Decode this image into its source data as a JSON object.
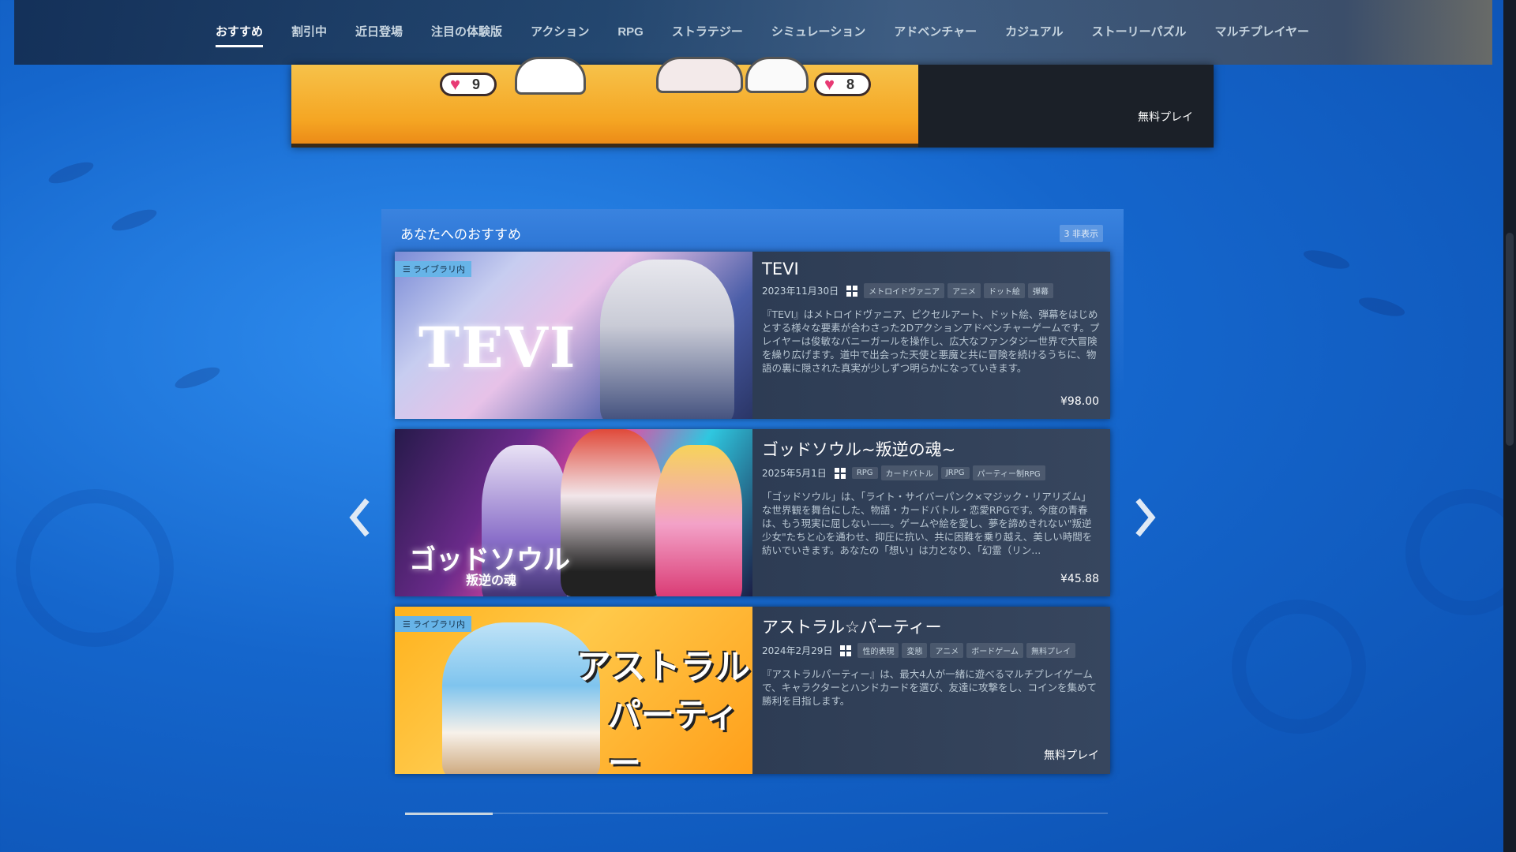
{
  "nav": {
    "tabs": [
      {
        "label": "おすすめ",
        "active": true
      },
      {
        "label": "割引中"
      },
      {
        "label": "近日登場"
      },
      {
        "label": "注目の体験版"
      },
      {
        "label": "アクション"
      },
      {
        "label": "RPG"
      },
      {
        "label": "ストラテジー"
      },
      {
        "label": "シミュレーション"
      },
      {
        "label": "アドベンチャー"
      },
      {
        "label": "カジュアル"
      },
      {
        "label": "ストーリーパズル"
      },
      {
        "label": "マルチプレイヤー"
      }
    ]
  },
  "banner": {
    "price": "無料プレイ",
    "hearts": [
      "9",
      "8"
    ]
  },
  "recommend": {
    "title": "あなたへのおすすめ",
    "hidden_badge": "3 非表示",
    "library_badge": "ライブラリ内",
    "cards": [
      {
        "title": "TEVI",
        "date": "2023年11月30日",
        "tags": [
          "メトロイドヴァニア",
          "アニメ",
          "ドット絵",
          "弾幕"
        ],
        "desc": "『TEVI』はメトロイドヴァニア、ピクセルアート、ドット絵、弾幕をはじめとする様々な要素が合わさった2Dアクションアドベンチャーゲームです。プレイヤーは俊敏なバニーガールを操作し、広大なファンタジー世界で大冒険を繰り広げます。道中で出会った天使と悪魔と共に冒険を続けるうちに、物語の裏に隠された真実が少しずつ明らかになっていきます。",
        "price": "¥98.00",
        "in_library": true,
        "logo": "TEVI"
      },
      {
        "title": "ゴッドソウル~叛逆の魂~",
        "date": "2025年5月1日",
        "tags": [
          "RPG",
          "カードバトル",
          "JRPG",
          "パーティー制RPG"
        ],
        "desc": "「ゴッドソウル」は、「ライト・サイバーパンク×マジック・リアリズム」な世界観を舞台にした、物語・カードバトル・恋愛RPGです。今度の青春は、もう現実に屈しない——。ゲームや絵を愛し、夢を諦めきれない\"叛逆少女\"たちと心を通わせ、抑圧に抗い、共に困難を乗り越え、美しい時間を紡いでいきます。あなたの「想い」は力となり、「幻霊（リン...",
        "price": "¥45.88",
        "in_library": false,
        "logo": "ゴッドソウル",
        "logo_sub": "叛逆の魂"
      },
      {
        "title": "アストラル☆パーティー",
        "date": "2024年2月29日",
        "tags": [
          "性的表現",
          "変態",
          "アニメ",
          "ボードゲーム",
          "無料プレイ"
        ],
        "desc": "『アストラルパーティー』は、最大4人が一緒に遊べるマルチプレイゲームで、キャラクターとハンドカードを選び、友達に攻撃をし、コインを集めて勝利を目指します。",
        "price": "無料プレイ",
        "in_library": true,
        "logo": "アストラル",
        "logo_sub": "パーティー"
      }
    ]
  },
  "carousel": {
    "progress": 0.125
  }
}
